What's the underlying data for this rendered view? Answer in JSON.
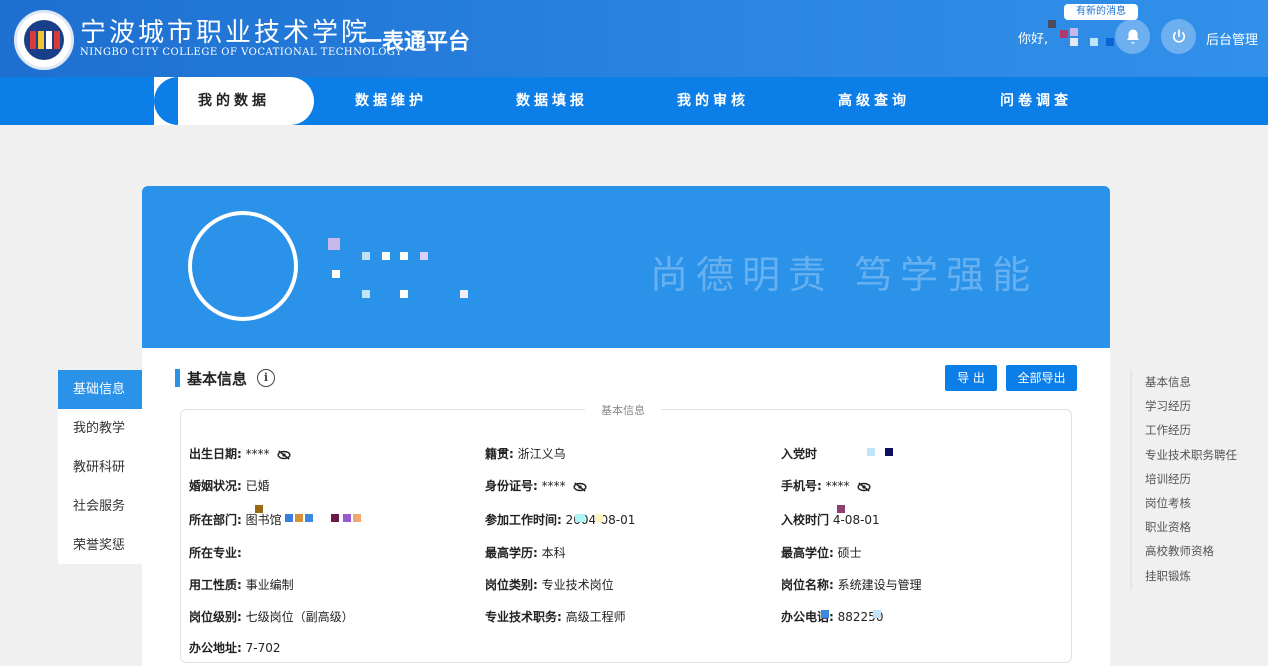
{
  "header": {
    "school_cn": "宁波城市职业技术学院",
    "school_en": "NINGBO CITY COLLEGE OF VOCATIONAL TECHNOLOGY",
    "platform": "一表通平台",
    "greeting": "你好,",
    "message_badge": "有新的消息",
    "admin_link": "后台管理",
    "bell_icon": "bell-icon",
    "power_icon": "power-icon"
  },
  "nav": {
    "items": [
      "我的数据",
      "数据维护",
      "数据填报",
      "我的审核",
      "高级查询",
      "问卷调查"
    ],
    "active": "我的数据"
  },
  "banner": {
    "motto": "尚德明责 笃学强能"
  },
  "left_menu": {
    "items": [
      "基础信息",
      "我的教学",
      "教研科研",
      "社会服务",
      "荣誉奖惩"
    ],
    "active": "基础信息"
  },
  "section": {
    "title": "基本信息",
    "legend": "基本信息",
    "export_label": "导 出",
    "export_all_label": "全部导出"
  },
  "fields": {
    "birth_label": "出生日期:",
    "birth_value": "****",
    "native_label": "籍贯:",
    "native_value": "浙江义乌",
    "party_label": "入党时",
    "marital_label": "婚姻状况:",
    "marital_value": "已婚",
    "id_label": "身份证号:",
    "id_value": "****",
    "phone_label": "手机号:",
    "phone_value": "****",
    "dept_label": "所在部门:",
    "dept_value": "图书馆",
    "work_label": "参加工作时间:",
    "work_value": "2004-08-01",
    "join_label": "入校时门",
    "join_value": "4-08-01",
    "major_label": "所在专业:",
    "edu_label": "最高学历:",
    "edu_value": "本科",
    "degree_label": "最高学位:",
    "degree_value": "硕士",
    "employ_label": "用工性质:",
    "employ_value": "事业编制",
    "pos_type_label": "岗位类别:",
    "pos_type_value": "专业技术岗位",
    "pos_name_label": "岗位名称:",
    "pos_name_value": "系统建设与管理",
    "pos_level_label": "岗位级别:",
    "pos_level_value": "七级岗位（副高级）",
    "title_label": "专业技术职务:",
    "title_value": "高级工程师",
    "office_tel_label": "办公电话:",
    "office_tel_value": "882250",
    "address_label": "办公地址:",
    "address_value": "7-702"
  },
  "anchors": [
    "基本信息",
    "学习经历",
    "工作经历",
    "专业技术职务聘任",
    "培训经历",
    "岗位考核",
    "职业资格",
    "高校教师资格",
    "挂职锻炼"
  ],
  "colors": {
    "primary": "#0b7ee7",
    "banner": "#2b92ea"
  }
}
